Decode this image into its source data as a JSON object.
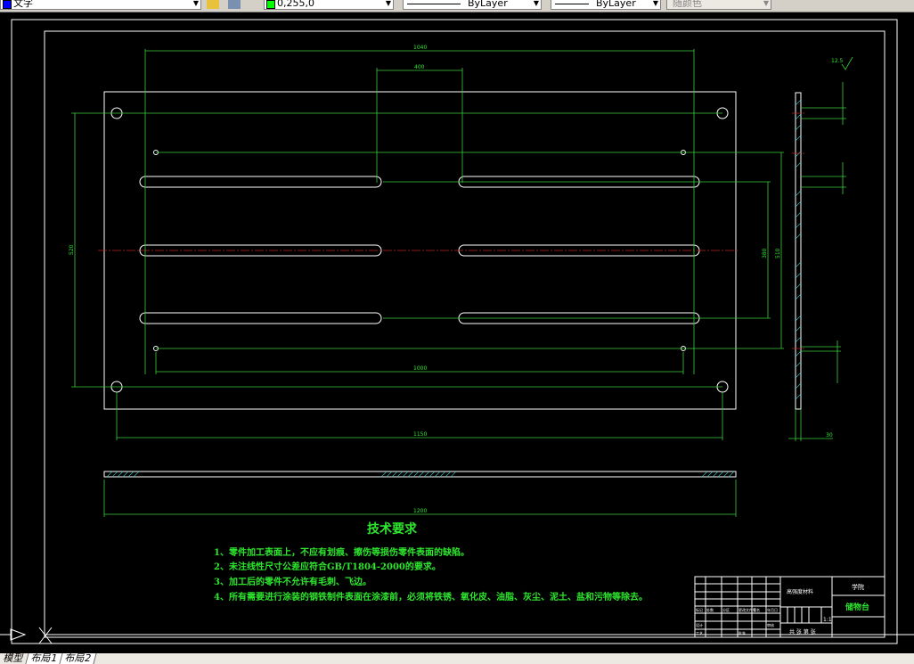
{
  "toolbar": {
    "text_style": "文字",
    "color": "0,255,0",
    "color_swatch": "#00ff00",
    "linetype": "ByLayer",
    "lineweight": "ByLayer",
    "plot_style": "随颜色"
  },
  "drawing": {
    "dimensions": {
      "top_overall": "1040",
      "top_middle": "400",
      "left_height": "520",
      "right_inner": "380",
      "right_outer": "510",
      "inner_width": "1000",
      "hole_span": "1150",
      "overall_width": "1200",
      "side_thickness": "30",
      "roughness": "12.5"
    },
    "tech_requirements": {
      "title": "技术要求",
      "items": [
        "1、零件加工表面上，不应有划痕、擦伤等损伤零件表面的缺陷。",
        "2、未注线性尺寸公差应符合GB/T1804-2000的要求。",
        "3、加工后的零件不允许有毛刺、飞边。",
        "4、所有需要进行涂装的钢铁制件表面在涂漆前，必须将铁锈、氧化皮、油脂、灰尘、泥土、盐和污物等除去。"
      ]
    },
    "title_block": {
      "material": "高强度材料",
      "org": "学院",
      "part_name": "储物台",
      "scale": "1:1",
      "labels": [
        "标记",
        "处数",
        "分区",
        "更改文件号",
        "签名",
        "年月日"
      ],
      "designer": "设计",
      "checker": "审核",
      "process": "工艺",
      "approve": "批准",
      "sheets": "共 张 第 张"
    }
  },
  "tabs": [
    "模型",
    "布局1",
    "布局2"
  ]
}
